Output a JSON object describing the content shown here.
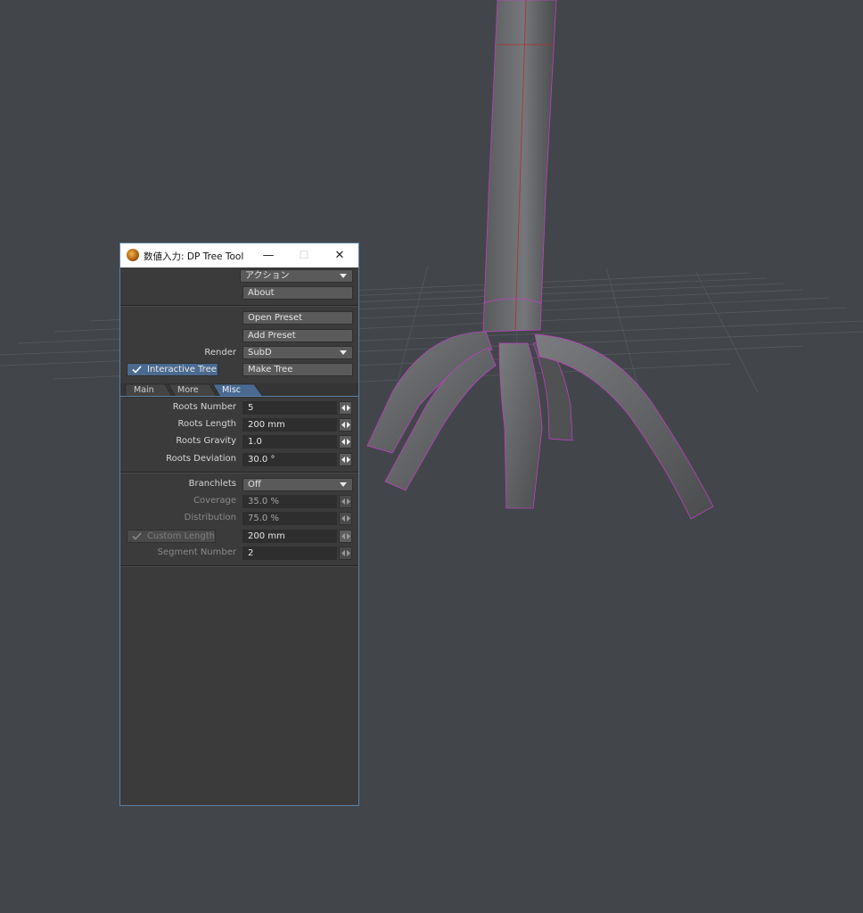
{
  "window": {
    "title": "数値入力: DP Tree Tool",
    "minimize": "—",
    "maximize": "☐",
    "close": "✕"
  },
  "toolbar": {
    "actions_label": "アクション",
    "about_label": "About",
    "open_preset_label": "Open Preset",
    "add_preset_label": "Add Preset",
    "render_label": "Render",
    "render_value": "SubD",
    "interactive_tree_label": "Interactive Tree",
    "make_tree_label": "Make Tree"
  },
  "tabs": [
    {
      "label": "Main"
    },
    {
      "label": "More"
    },
    {
      "label": "Misc"
    }
  ],
  "roots": {
    "number_label": "Roots Number",
    "number_value": "5",
    "length_label": "Roots Length",
    "length_value": "200 mm",
    "gravity_label": "Roots Gravity",
    "gravity_value": "1.0",
    "deviation_label": "Roots Deviation",
    "deviation_value": "30.0 °"
  },
  "branchlets": {
    "label": "Branchlets",
    "value": "Off",
    "coverage_label": "Coverage",
    "coverage_value": "35.0 %",
    "distribution_label": "Distribution",
    "distribution_value": "75.0 %",
    "custom_length_label": "Custom Length",
    "custom_length_value": "200 mm",
    "segment_number_label": "Segment Number",
    "segment_number_value": "2"
  },
  "colors": {
    "background": "#42464a",
    "panel": "#3b3b3b",
    "accent": "#4a6a8f",
    "wire": "#c040c0"
  }
}
